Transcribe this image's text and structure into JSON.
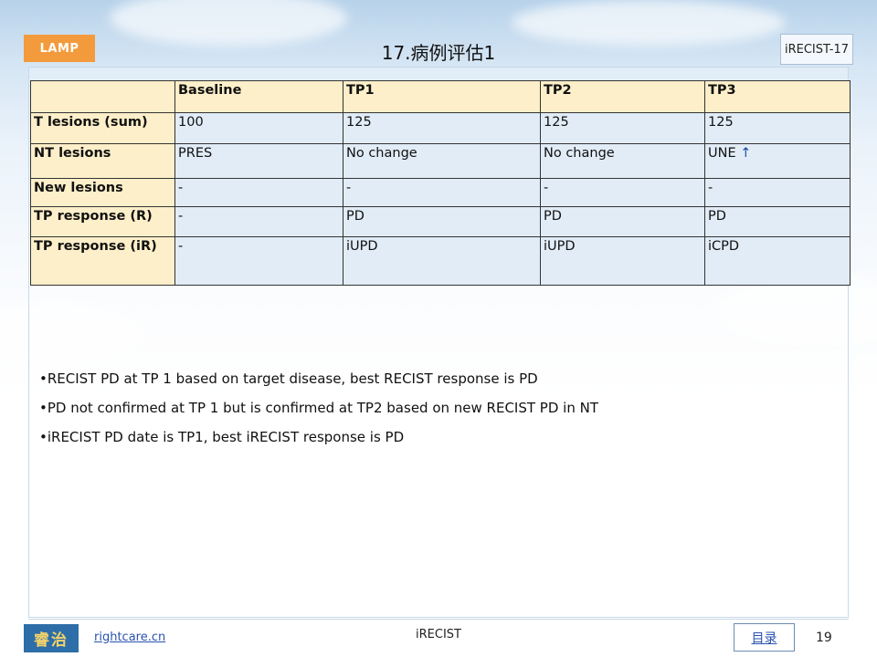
{
  "header": {
    "logo_text": "LAMP",
    "title": "17.病例评估1",
    "tag": "iRECIST-17"
  },
  "table": {
    "columns": [
      "",
      "Baseline",
      "TP1",
      "TP2",
      "TP3"
    ],
    "rows": [
      {
        "label": "T lesions (sum)",
        "cells": [
          "100",
          "125",
          "125",
          "125"
        ]
      },
      {
        "label": "NT lesions",
        "cells": [
          "PRES",
          "No change",
          "No change",
          "UNE"
        ]
      },
      {
        "label": "New lesions",
        "cells": [
          "-",
          "-",
          "-",
          "-"
        ]
      },
      {
        "label": "TP response (R)",
        "cells": [
          "-",
          "PD",
          "PD",
          "PD"
        ]
      },
      {
        "label": "TP response (iR)",
        "cells": [
          "-",
          "iUPD",
          "iUPD",
          "iCPD"
        ]
      }
    ]
  },
  "bullets": [
    "•RECIST PD at TP 1 based on target disease, best RECIST response is PD",
    "•PD not confirmed at TP 1 but is confirmed at TP2 based on new RECIST PD in NT",
    "•iRECIST PD date is TP1, best iRECIST response is PD"
  ],
  "footer": {
    "logo_text": "睿治",
    "site": "rightcare.cn",
    "center": "iRECIST",
    "toc": "目录",
    "page": "19"
  },
  "colors": {
    "accent": "#f39b3c",
    "header_cell": "#fdefc9",
    "body_cell": "#e1ecf7",
    "link": "#2a52b0"
  }
}
